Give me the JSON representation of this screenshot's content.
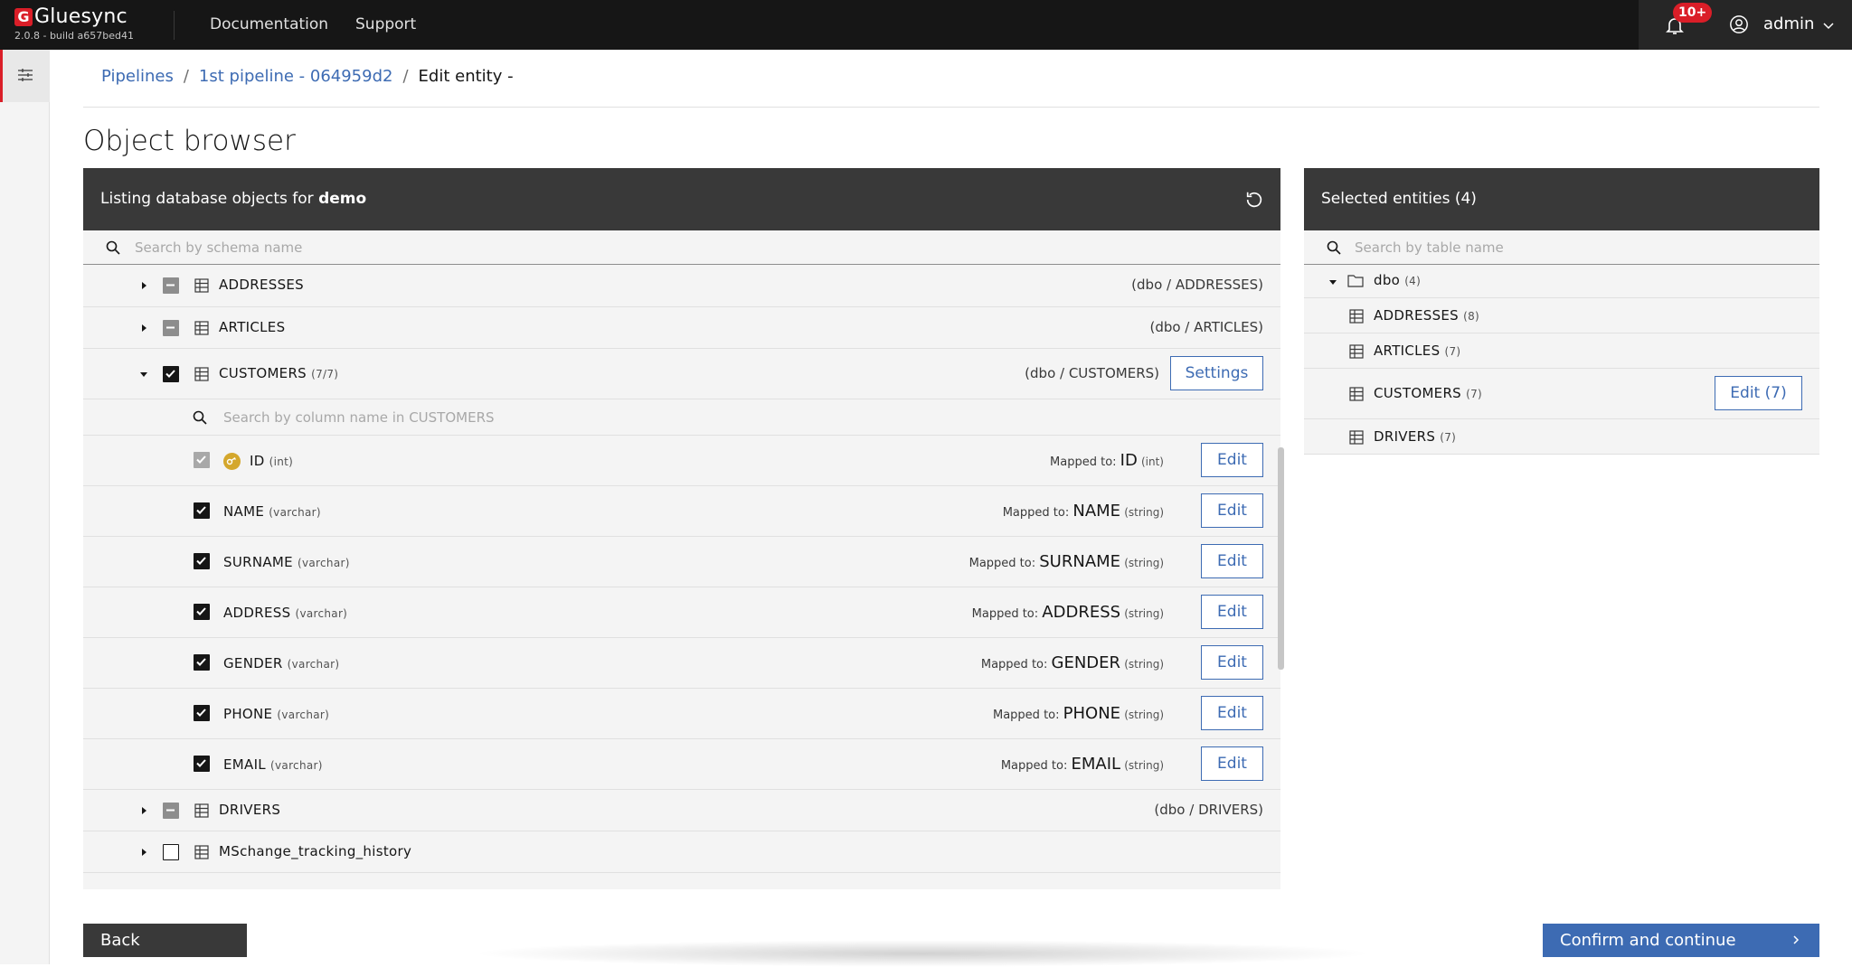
{
  "app": {
    "name": "Gluesync",
    "build": "2.0.8 - build a657bed41",
    "nav": [
      "Documentation",
      "Support"
    ],
    "notifications_badge": "10+",
    "user": "admin",
    "accent_color": "#da1e28",
    "link_color": "#3d6bb3"
  },
  "breadcrumb": {
    "items": [
      "Pipelines",
      "1st pipeline - 064959d2",
      "Edit entity -"
    ],
    "separator": "/"
  },
  "page": {
    "title": "Object browser"
  },
  "left_panel": {
    "header_prefix": "Listing database objects for",
    "header_db": "demo",
    "search_placeholder": "Search by schema name",
    "tables": [
      {
        "name": "ADDRESSES",
        "count": "",
        "path": "(dbo / ADDRESSES)",
        "state": "indeterminate",
        "expanded": false
      },
      {
        "name": "ARTICLES",
        "count": "",
        "path": "(dbo / ARTICLES)",
        "state": "indeterminate",
        "expanded": false
      },
      {
        "name": "CUSTOMERS",
        "count": "(7/7)",
        "path": "(dbo / CUSTOMERS)",
        "state": "checked",
        "expanded": true,
        "settings_label": "Settings"
      },
      {
        "name": "DRIVERS",
        "count": "",
        "path": "(dbo / DRIVERS)",
        "state": "indeterminate",
        "expanded": false
      },
      {
        "name": "MSchange_tracking_history",
        "count": "",
        "path": "",
        "state": "unchecked",
        "expanded": false
      }
    ],
    "column_search_placeholder": "Search by column name in CUSTOMERS",
    "mapped_prefix": "Mapped to:",
    "edit_label": "Edit",
    "columns": [
      {
        "name": "ID",
        "type": "(int)",
        "mapped": "ID",
        "mapped_type": "(int)",
        "key": true
      },
      {
        "name": "NAME",
        "type": "(varchar)",
        "mapped": "NAME",
        "mapped_type": "(string)",
        "key": false
      },
      {
        "name": "SURNAME",
        "type": "(varchar)",
        "mapped": "SURNAME",
        "mapped_type": "(string)",
        "key": false
      },
      {
        "name": "ADDRESS",
        "type": "(varchar)",
        "mapped": "ADDRESS",
        "mapped_type": "(string)",
        "key": false
      },
      {
        "name": "GENDER",
        "type": "(varchar)",
        "mapped": "GENDER",
        "mapped_type": "(string)",
        "key": false
      },
      {
        "name": "PHONE",
        "type": "(varchar)",
        "mapped": "PHONE",
        "mapped_type": "(string)",
        "key": false
      },
      {
        "name": "EMAIL",
        "type": "(varchar)",
        "mapped": "EMAIL",
        "mapped_type": "(string)",
        "key": false
      }
    ]
  },
  "right_panel": {
    "header": "Selected entities (4)",
    "search_placeholder": "Search by table name",
    "schema": {
      "name": "dbo",
      "count": "(4)"
    },
    "entities": [
      {
        "name": "ADDRESSES",
        "count": "(8)",
        "edit": ""
      },
      {
        "name": "ARTICLES",
        "count": "(7)",
        "edit": ""
      },
      {
        "name": "CUSTOMERS",
        "count": "(7)",
        "edit": "Edit (7)"
      },
      {
        "name": "DRIVERS",
        "count": "(7)",
        "edit": ""
      }
    ]
  },
  "footer": {
    "back_label": "Back",
    "confirm_label": "Confirm and continue"
  }
}
